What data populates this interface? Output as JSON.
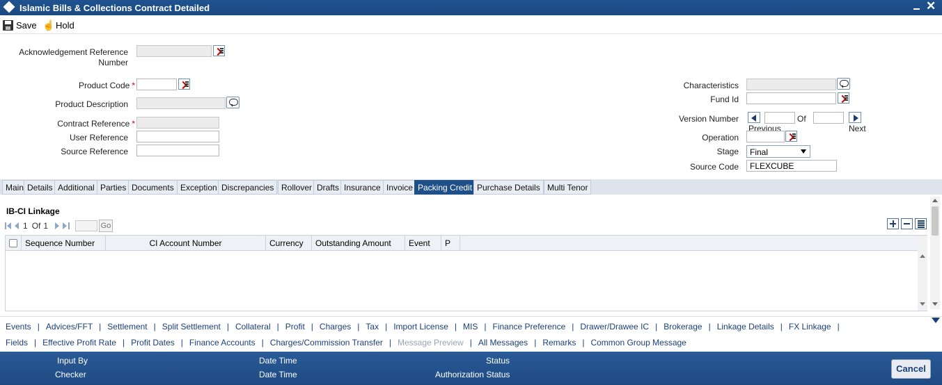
{
  "window": {
    "title": "Islamic Bills & Collections Contract Detailed"
  },
  "toolbar": {
    "save_label": "Save",
    "hold_label": "Hold"
  },
  "form": {
    "ack_ref_label_1": "Acknowledgement Reference",
    "ack_ref_label_2": "Number",
    "product_code_label": "Product Code",
    "product_desc_label": "Product Description",
    "contract_ref_label": "Contract Reference",
    "user_ref_label": "User Reference",
    "source_ref_label": "Source Reference",
    "required_mark": "*",
    "characteristics_label": "Characteristics",
    "fund_id_label": "Fund Id",
    "version_label": "Version Number",
    "of_label": "Of",
    "previous_label": "Previous",
    "next_label": "Next",
    "operation_label": "Operation",
    "stage_label": "Stage",
    "stage_value": "Final",
    "source_code_label": "Source Code",
    "source_code_value": "FLEXCUBE"
  },
  "tabs": [
    {
      "label": "Main"
    },
    {
      "label": "Details"
    },
    {
      "label": "Additional"
    },
    {
      "label": "Parties"
    },
    {
      "label": "Documents"
    },
    {
      "label": "Exception"
    },
    {
      "label": "Discrepancies"
    },
    {
      "label": "Rollover"
    },
    {
      "label": "Drafts"
    },
    {
      "label": "Insurance"
    },
    {
      "label": "Invoice"
    },
    {
      "label": "Packing Credit"
    },
    {
      "label": "Purchase Details"
    },
    {
      "label": "Multi Tenor"
    }
  ],
  "section": {
    "title": "IB-CI Linkage",
    "pager_current": "1",
    "pager_of": "Of",
    "pager_total": "1",
    "go_label": "Go",
    "columns": [
      "Sequence Number",
      "CI Account Number",
      "Currency",
      "Outstanding Amount",
      "Event",
      "P"
    ]
  },
  "links": {
    "row1": [
      "Events",
      "Advices/FFT",
      "Settlement",
      "Split Settlement",
      "Collateral",
      "Profit",
      "Charges",
      "Tax",
      "Import License",
      "MIS",
      "Finance Preference",
      "Drawer/Drawee IC",
      "Brokerage",
      "Linkage Details",
      "FX Linkage"
    ],
    "row2": [
      "Fields",
      "Effective Profit Rate",
      "Profit Dates",
      "Finance Accounts",
      "Charges/Commission Transfer",
      "Message Preview",
      "All Messages",
      "Remarks",
      "Common Group Message"
    ],
    "separator": "|"
  },
  "footer": {
    "input_by": "Input By",
    "checker": "Checker",
    "date_time_1": "Date Time",
    "date_time_2": "Date Time",
    "status": "Status",
    "auth_status": "Authorization Status",
    "cancel_label": "Cancel"
  },
  "colors": {
    "title_bar": "#1f4f88",
    "active_tab": "#1f4f88",
    "link": "#1a3f7a",
    "required": "#cc0000"
  }
}
